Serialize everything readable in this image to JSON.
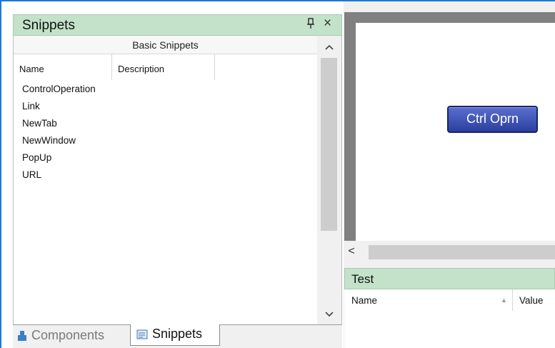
{
  "snippets_panel": {
    "title": "Snippets",
    "pin_glyph": "ᵖ",
    "close_glyph": "×",
    "group_header": "Basic Snippets",
    "columns": [
      "Name",
      "Description"
    ],
    "items": [
      "ControlOperation",
      "Link",
      "NewTab",
      "NewWindow",
      "PopUp",
      "URL"
    ],
    "tabs": [
      {
        "label": "Components",
        "icon": "components-icon",
        "active": false
      },
      {
        "label": "Snippets",
        "icon": "snippets-icon",
        "active": true
      }
    ]
  },
  "designer": {
    "button_label": "Ctrl Oprn",
    "scroll_left_glyph": "<"
  },
  "test_panel": {
    "title": "Test",
    "columns": [
      "Name",
      "Value"
    ]
  },
  "colors": {
    "panel_title_bg": "#c3e2c9",
    "accent_border": "#1e78d6",
    "button_gradient_top": "#5a6fd0",
    "button_gradient_bottom": "#2c3f9e"
  }
}
